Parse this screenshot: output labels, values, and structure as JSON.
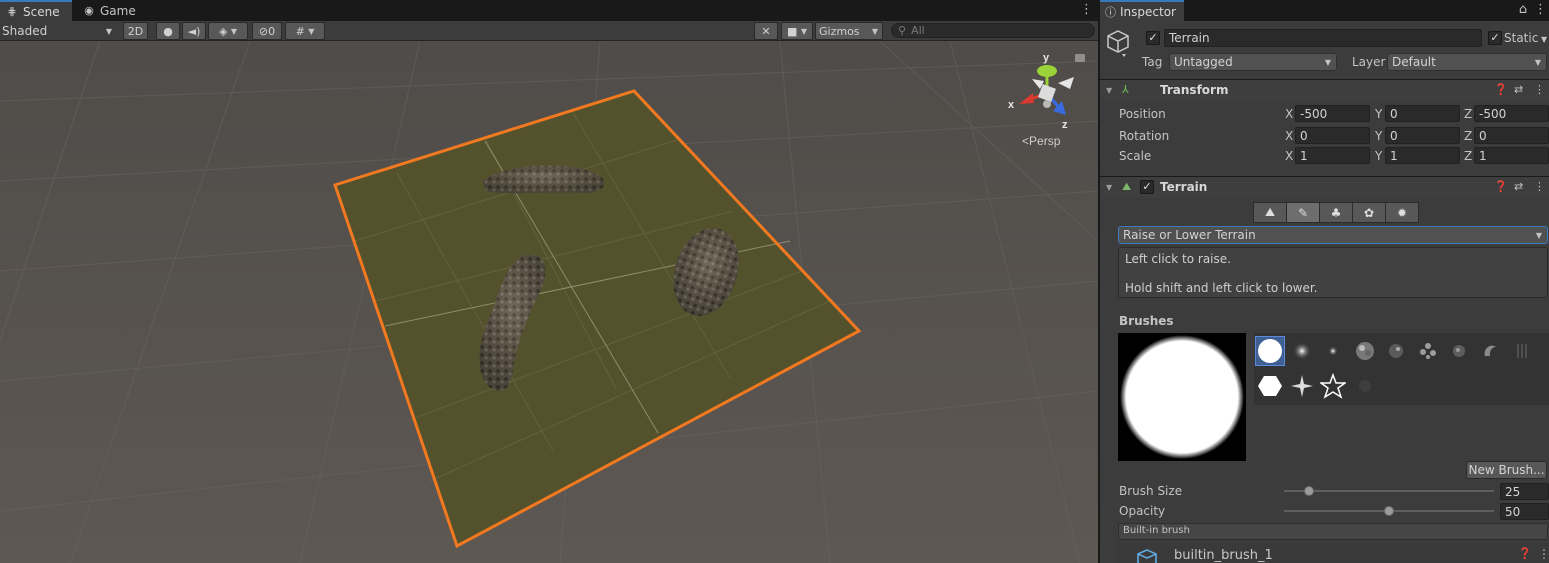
{
  "scene_tabs": {
    "scene": "Scene",
    "game": "Game"
  },
  "scene_toolbar": {
    "shading_mode": "Shaded",
    "two_d": "2D",
    "hidden_count": "0",
    "gizmos": "Gizmos",
    "search_placeholder": "All"
  },
  "gizmo": {
    "y": "y",
    "x": "x",
    "z": "z",
    "projection": "Persp"
  },
  "inspector": {
    "tab_title": "Inspector",
    "object_name": "Terrain",
    "static_label": "Static",
    "tag_label": "Tag",
    "tag_value": "Untagged",
    "layer_label": "Layer",
    "layer_value": "Default",
    "transform": {
      "title": "Transform",
      "position_label": "Position",
      "rotation_label": "Rotation",
      "scale_label": "Scale",
      "axis_x": "X",
      "axis_y": "Y",
      "axis_z": "Z",
      "position": {
        "x": "-500",
        "y": "0",
        "z": "-500"
      },
      "rotation": {
        "x": "0",
        "y": "0",
        "z": "0"
      },
      "scale": {
        "x": "1",
        "y": "1",
        "z": "1"
      }
    },
    "terrain": {
      "title": "Terrain",
      "tool_mode": "Raise or Lower Terrain",
      "help_line1": "Left click to raise.",
      "help_line2": "Hold shift and left click to lower.",
      "brushes_label": "Brushes",
      "new_brush": "New Brush...",
      "brush_size_label": "Brush Size",
      "brush_size": "25",
      "brush_size_fraction": 0.12,
      "opacity_label": "Opacity",
      "opacity": "50",
      "opacity_fraction": 0.5,
      "builtin_header": "Built-in brush",
      "brush_name": "builtin_brush_1"
    }
  },
  "colors": {
    "selection_outline": "#f2791f",
    "terrain_fill": "#53522c",
    "accent": "#3a79bb",
    "gizmo_x": "#d93a2f",
    "gizmo_y": "#9bd43a",
    "gizmo_z": "#3a6ae0"
  }
}
